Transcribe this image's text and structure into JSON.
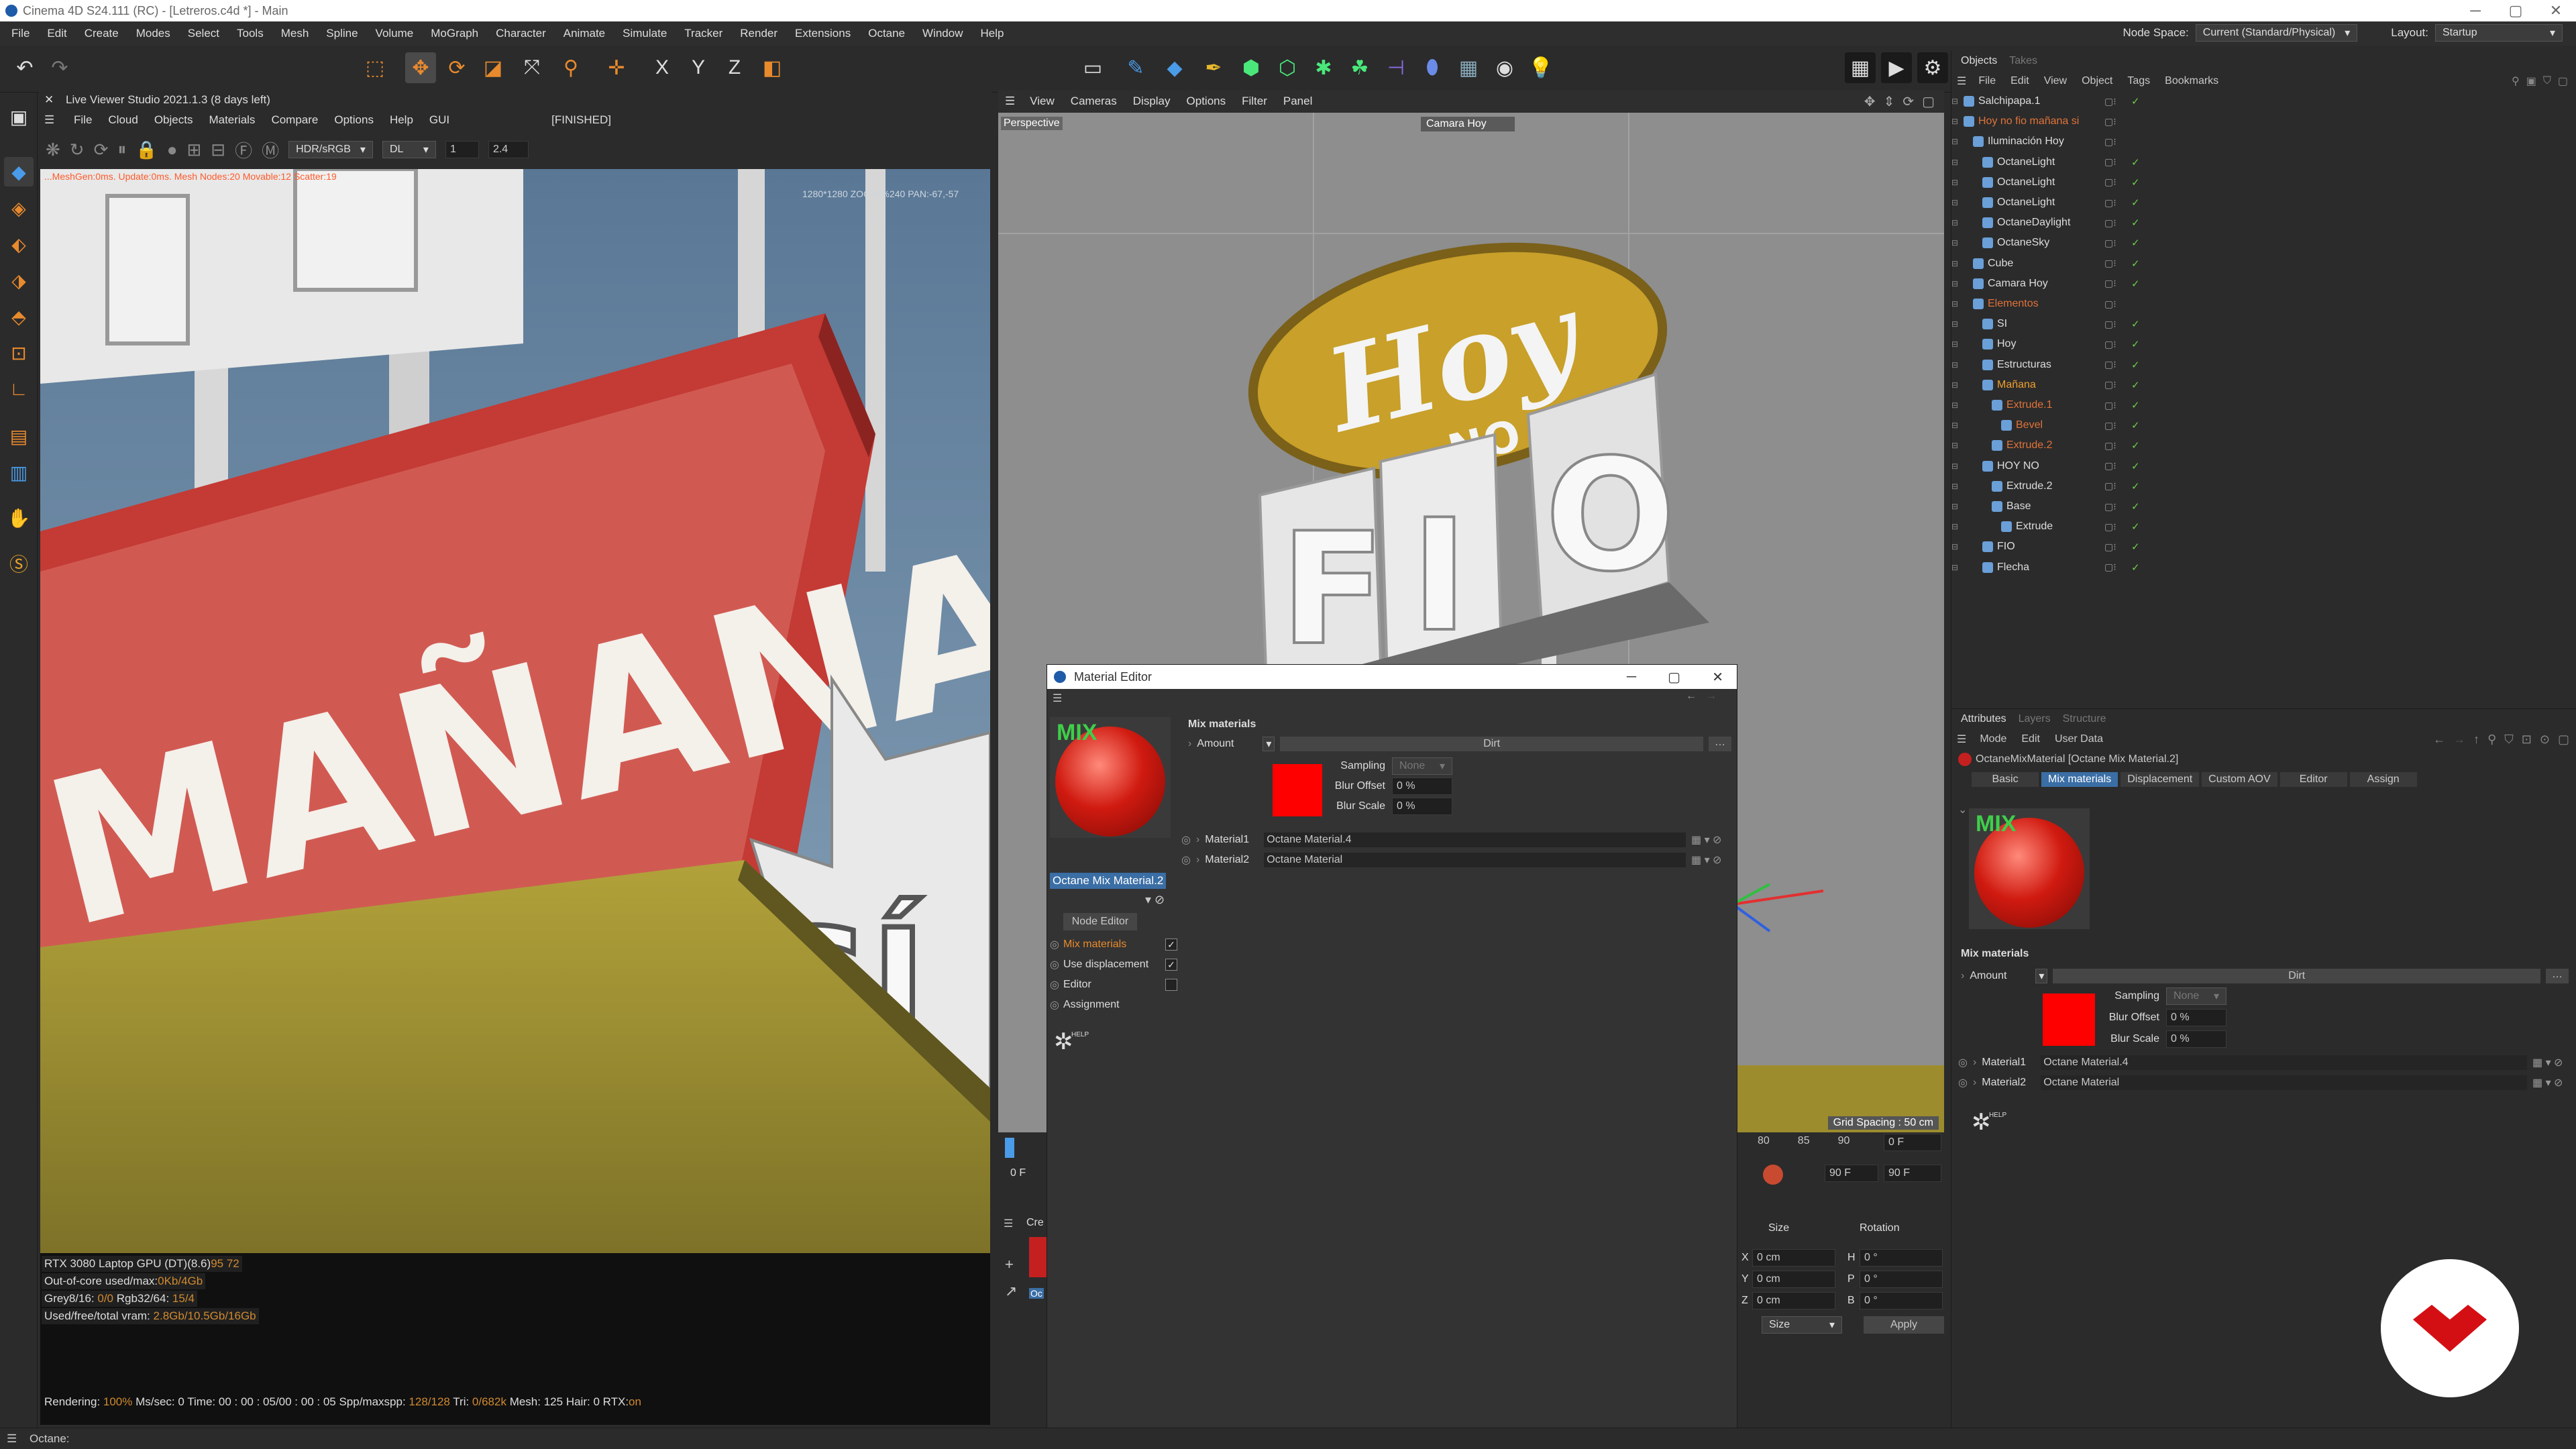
{
  "window": {
    "title": "Cinema 4D S24.111 (RC) - [Letreros.c4d *] - Main",
    "minimize_glyph": "─",
    "maximize_glyph": "▢",
    "close_glyph": "✕"
  },
  "menubar": {
    "items": [
      "File",
      "Edit",
      "Create",
      "Modes",
      "Select",
      "Tools",
      "Mesh",
      "Spline",
      "Volume",
      "MoGraph",
      "Character",
      "Animate",
      "Simulate",
      "Tracker",
      "Render",
      "Extensions",
      "Octane",
      "Window",
      "Help"
    ],
    "node_space_label": "Node Space:",
    "node_space_value": "Current (Standard/Physical)",
    "layout_label": "Layout:",
    "layout_value": "Startup"
  },
  "live_viewer": {
    "title": "Live Viewer Studio 2021.1.3 (8 days left)",
    "menu": [
      "File",
      "Cloud",
      "Objects",
      "Materials",
      "Compare",
      "Options",
      "Help",
      "GUI"
    ],
    "status": "[FINISHED]",
    "color_mode": "HDR/sRGB",
    "channel": "DL",
    "value1": "1",
    "value2": "2.4",
    "overlay_line": "...MeshGen:0ms. Update:0ms. Mesh  Nodes:20  Movable:12  Scatter:19",
    "overlay_info": "1280*1280 ZOOM:%240 PAN:-67,-57",
    "sign_text": "MAÑANA",
    "si_text": "SÍ",
    "stats": [
      {
        "label": "RTX 3080 Laptop GPU (DT)(8.6)",
        "value": "95    72"
      },
      {
        "label": "Out-of-core used/max:",
        "value": "0Kb/4Gb"
      },
      {
        "label": "Grey8/16: ",
        "value": "0/0",
        "label2": "          Rgb32/64: ",
        "value2": "15/4"
      },
      {
        "label": "Used/free/total vram: ",
        "value": "2.8Gb/10.5Gb/16Gb"
      }
    ],
    "render_line": {
      "rendering_label": "Rendering: ",
      "rendering": "100%",
      "mssec_label": "  Ms/sec: ",
      "mssec": "0",
      "time_label": "   Time: ",
      "time": "00 : 00 : 05/00 : 00 : 05",
      "spp_label": "   Spp/maxspp: ",
      "spp": "128/128",
      "tri_label": "   Tri: ",
      "tri": "0/682k",
      "mesh_label": "   Mesh: ",
      "mesh": "125",
      "hair_label": "   Hair: ",
      "hair": "0",
      "rtx_label": "   RTX:",
      "rtx": "on"
    }
  },
  "viewport": {
    "menu": [
      "View",
      "Cameras",
      "Display",
      "Options",
      "Filter",
      "Panel"
    ],
    "mode": "Perspective",
    "camera": "Camara Hoy",
    "grid_spacing": "Grid Spacing : 50 cm",
    "sign_hoy": "Hoy",
    "sign_no": "NO",
    "letters": [
      "F",
      "I",
      "O"
    ]
  },
  "timeline": {
    "frame_left": "0 F",
    "ticks": [
      "80",
      "85",
      "90"
    ],
    "field_a": "0 F",
    "field_b": "90 F",
    "field_c": "90 F"
  },
  "coords": {
    "size_header": "Size",
    "rotation_header": "Rotation",
    "rows": [
      {
        "axis": "X",
        "size": "0 cm",
        "rot_axis": "H",
        "rot": "0 °"
      },
      {
        "axis": "Y",
        "size": "0 cm",
        "rot_axis": "P",
        "rot": "0 °"
      },
      {
        "axis": "Z",
        "size": "0 cm",
        "rot_axis": "B",
        "rot": "0 °"
      }
    ],
    "mode_select": "Size",
    "apply_label": "Apply",
    "partial_label": "Cre",
    "partial_label2": "Oc"
  },
  "material_editor": {
    "title": "Material Editor",
    "mix_label": "MIX",
    "material_name": "Octane Mix Material.2",
    "node_editor_btn": "Node Editor",
    "channels": [
      {
        "label": "Mix materials",
        "checked": true,
        "active": true
      },
      {
        "label": "Use displacement",
        "checked": true,
        "active": false
      },
      {
        "label": "Editor",
        "checked": false,
        "active": false
      },
      {
        "label": "Assignment",
        "checked": null,
        "active": false
      }
    ],
    "section_title": "Mix materials",
    "amount_label": "Amount",
    "amount_value": "Dirt",
    "sampling_label": "Sampling",
    "sampling_value": "None",
    "blur_offset_label": "Blur Offset",
    "blur_offset_value": "0 %",
    "blur_scale_label": "Blur Scale",
    "blur_scale_value": "0 %",
    "material1_label": "Material1",
    "material1_value": "Octane Material.4",
    "material2_label": "Material2",
    "material2_value": "Octane Material",
    "help_label": "HELP",
    "swatch_color": "#ff0000"
  },
  "object_manager": {
    "tabs": [
      "Objects",
      "Takes"
    ],
    "menu": [
      "File",
      "Edit",
      "View",
      "Object",
      "Tags",
      "Bookmarks"
    ],
    "items": [
      {
        "name": "Salchipapa.1",
        "depth": 0,
        "color": "#ddd"
      },
      {
        "name": "Hoy no fio mañana si",
        "depth": 0,
        "color": "#e0733a"
      },
      {
        "name": "Iluminación Hoy",
        "depth": 1,
        "color": "#ddd"
      },
      {
        "name": "OctaneLight",
        "depth": 2,
        "color": "#ddd"
      },
      {
        "name": "OctaneLight",
        "depth": 2,
        "color": "#ddd"
      },
      {
        "name": "OctaneLight",
        "depth": 2,
        "color": "#ddd"
      },
      {
        "name": "OctaneDaylight",
        "depth": 2,
        "color": "#ddd"
      },
      {
        "name": "OctaneSky",
        "depth": 2,
        "color": "#ddd"
      },
      {
        "name": "Cube",
        "depth": 1,
        "color": "#ddd"
      },
      {
        "name": "Camara Hoy",
        "depth": 1,
        "color": "#ddd"
      },
      {
        "name": "Elementos",
        "depth": 1,
        "color": "#e0733a"
      },
      {
        "name": "SI",
        "depth": 2,
        "color": "#ddd"
      },
      {
        "name": "Hoy",
        "depth": 2,
        "color": "#ddd"
      },
      {
        "name": "Estructuras",
        "depth": 2,
        "color": "#ddd"
      },
      {
        "name": "Mañana",
        "depth": 2,
        "color": "#f0a030"
      },
      {
        "name": "Extrude.1",
        "depth": 3,
        "color": "#e0733a"
      },
      {
        "name": "Bevel",
        "depth": 4,
        "color": "#e0733a"
      },
      {
        "name": "Extrude.2",
        "depth": 3,
        "color": "#e0733a"
      },
      {
        "name": "HOY NO",
        "depth": 2,
        "color": "#ddd"
      },
      {
        "name": "Extrude.2",
        "depth": 3,
        "color": "#ddd"
      },
      {
        "name": "Base",
        "depth": 3,
        "color": "#ddd"
      },
      {
        "name": "Extrude",
        "depth": 4,
        "color": "#ddd"
      },
      {
        "name": "FIO",
        "depth": 2,
        "color": "#ddd"
      },
      {
        "name": "Flecha",
        "depth": 2,
        "color": "#ddd"
      }
    ]
  },
  "attributes": {
    "tabs": [
      "Attributes",
      "Layers",
      "Structure"
    ],
    "menu": [
      "Mode",
      "Edit",
      "User Data"
    ],
    "object_title": "OctaneMixMaterial [Octane Mix Material.2]",
    "subtabs": [
      "Basic",
      "Mix materials",
      "Displacement",
      "Custom AOV",
      "Editor",
      "Assign"
    ],
    "active_subtab": "Mix materials",
    "mix_label": "MIX",
    "section_title": "Mix materials",
    "amount_label": "Amount",
    "amount_value": "Dirt",
    "sampling_label": "Sampling",
    "sampling_value": "None",
    "blur_offset_label": "Blur Offset",
    "blur_offset_value": "0 %",
    "blur_scale_label": "Blur Scale",
    "blur_scale_value": "0 %",
    "material1_label": "Material1",
    "material1_value": "Octane Material.4",
    "material2_label": "Material2",
    "material2_value": "Octane Material",
    "help_label": "HELP"
  },
  "statusbar": {
    "text": "Octane:"
  },
  "colors": {
    "accent": "#e88a2d",
    "selection": "#3a6ea5",
    "brand": "#d40f14"
  }
}
